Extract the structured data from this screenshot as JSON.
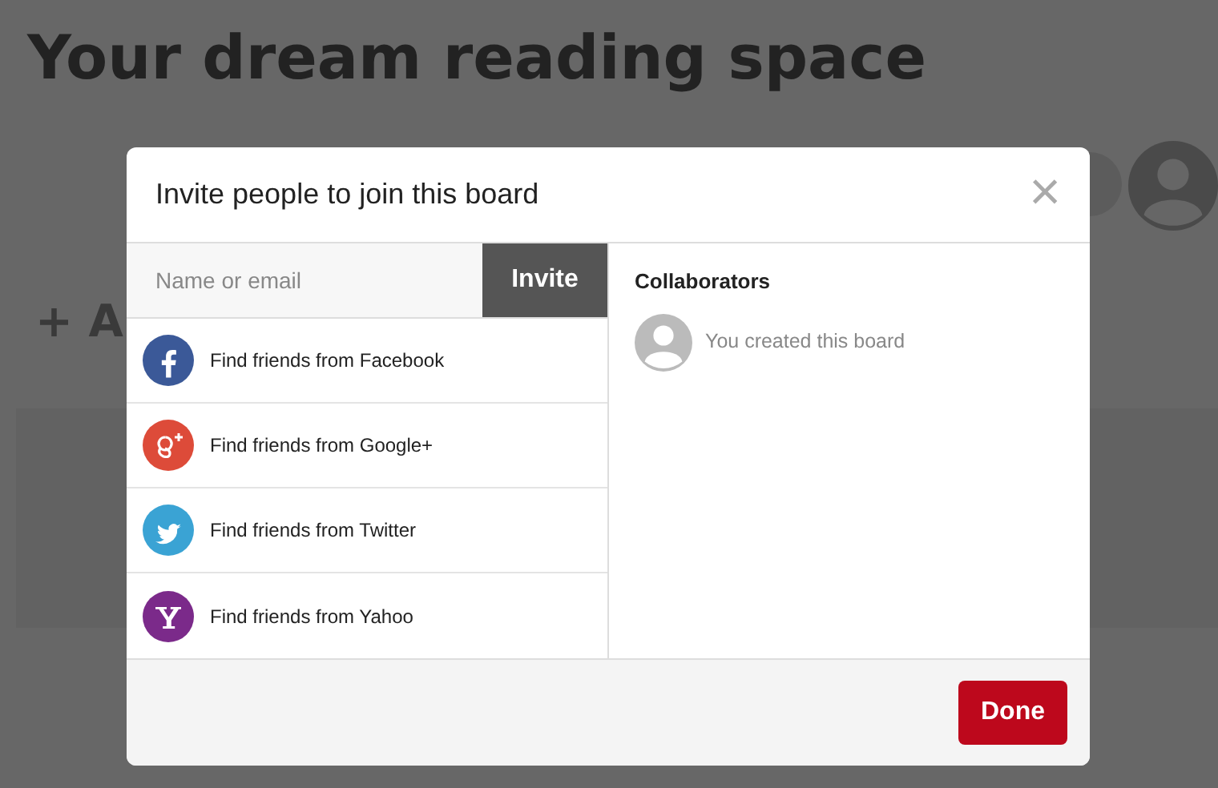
{
  "page": {
    "title": "Your dream reading space",
    "add_label": "+ A"
  },
  "dialog": {
    "title": "Invite people to join this board",
    "close": "×",
    "search": {
      "placeholder": "Name or email",
      "button": "Invite"
    },
    "providers": [
      {
        "kind": "facebook",
        "color": "#3b5998",
        "label": "Find friends from Facebook"
      },
      {
        "kind": "google",
        "color": "#dd4b39",
        "label": "Find friends from Google+"
      },
      {
        "kind": "twitter",
        "color": "#3aa3d4",
        "label": "Find friends from Twitter"
      },
      {
        "kind": "yahoo",
        "color": "#7b2a8a",
        "label": "Find friends from Yahoo"
      }
    ],
    "collaborators": {
      "heading": "Collaborators",
      "items": [
        {
          "label": "You created this board"
        }
      ]
    },
    "done": "Done"
  }
}
